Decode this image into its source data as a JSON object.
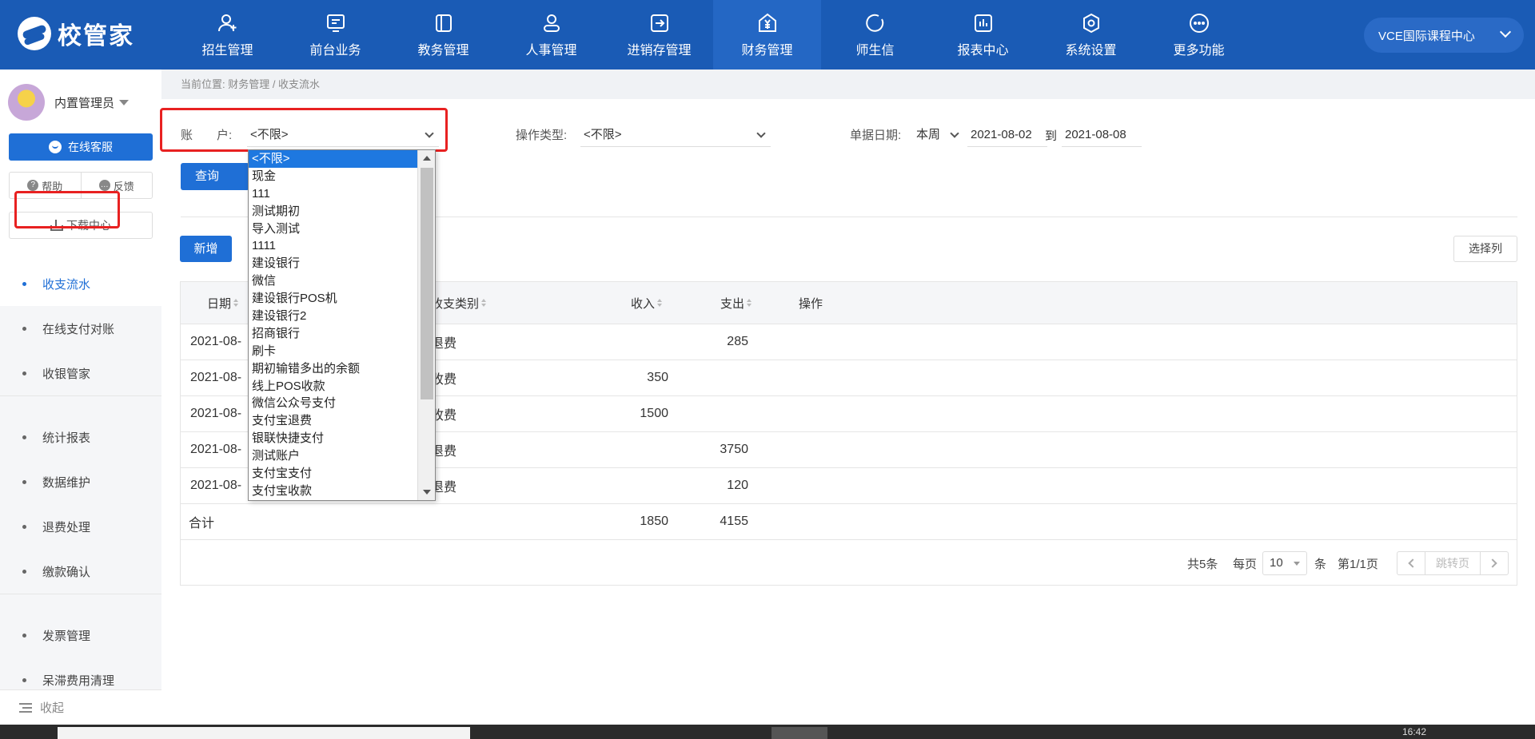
{
  "app": {
    "logo_text": "校管家"
  },
  "nav": [
    {
      "label": "招生管理",
      "icon": "user-add-icon"
    },
    {
      "label": "前台业务",
      "icon": "monitor-icon"
    },
    {
      "label": "教务管理",
      "icon": "book-icon"
    },
    {
      "label": "人事管理",
      "icon": "person-icon"
    },
    {
      "label": "进销存管理",
      "icon": "transfer-icon"
    },
    {
      "label": "财务管理",
      "icon": "money-bag-icon"
    },
    {
      "label": "师生信",
      "icon": "chat-icon"
    },
    {
      "label": "报表中心",
      "icon": "bar-chart-icon"
    },
    {
      "label": "系统设置",
      "icon": "settings-icon"
    },
    {
      "label": "更多功能",
      "icon": "more-icon"
    }
  ],
  "campus": "VCE国际课程中心",
  "sidebar": {
    "user_name": "内置管理员",
    "service": "在线客服",
    "help": "帮助",
    "feedback": "反馈",
    "download": "下载中心",
    "menu": [
      {
        "label": "收支流水"
      },
      {
        "label": "在线支付对账"
      },
      {
        "label": "收银管家"
      },
      {
        "label": "统计报表"
      },
      {
        "label": "数据维护"
      },
      {
        "label": "退费处理"
      },
      {
        "label": "缴款确认"
      },
      {
        "label": "发票管理"
      },
      {
        "label": "呆滞费用清理"
      }
    ],
    "collapse": "收起"
  },
  "breadcrumb": "当前位置: 财务管理 / 收支流水",
  "filters": {
    "account_label": "账　　户:",
    "account_value": "<不限>",
    "op_type_label": "操作类型:",
    "op_type_value": "<不限>",
    "date_label": "单据日期:",
    "date_range": "本周",
    "date_from": "2021-08-02",
    "date_to_label": "到",
    "date_to": "2021-08-08"
  },
  "buttons": {
    "query": "查询",
    "add": "新增",
    "select_columns": "选择列"
  },
  "table": {
    "headers": {
      "date": "日期",
      "category": "收支类别",
      "income": "收入",
      "expense": "支出",
      "action": "操作"
    },
    "rows": [
      {
        "date": "2021-08-",
        "category": "退费",
        "income": "",
        "expense": "285"
      },
      {
        "date": "2021-08-",
        "category": "收费",
        "income": "350",
        "expense": ""
      },
      {
        "date": "2021-08-",
        "category": "收费",
        "income": "1500",
        "expense": ""
      },
      {
        "date": "2021-08-",
        "category": "退费",
        "income": "",
        "expense": "3750"
      },
      {
        "date": "2021-08-",
        "category": "退费",
        "income": "",
        "expense": "120"
      }
    ],
    "total": {
      "label": "合计",
      "income": "1850",
      "expense": "4155"
    }
  },
  "pager": {
    "total": "共5条",
    "per_page_label": "每页",
    "per_page": "10",
    "unit": "条",
    "page_info": "第1/1页",
    "jump": "跳转页"
  },
  "dropdown": {
    "options": [
      "<不限>",
      "现金",
      "111",
      "测试期初",
      "导入测试",
      "1111",
      "建设银行",
      "微信",
      "建设银行POS机",
      "建设银行2",
      "招商银行",
      "刷卡",
      "期初输错多出的余额",
      "线上POS收款",
      "微信公众号支付",
      "支付宝退费",
      "银联快捷支付",
      "测试账户",
      "支付宝支付",
      "支付宝收款"
    ]
  },
  "taskbar": {
    "clock": "16:42"
  }
}
